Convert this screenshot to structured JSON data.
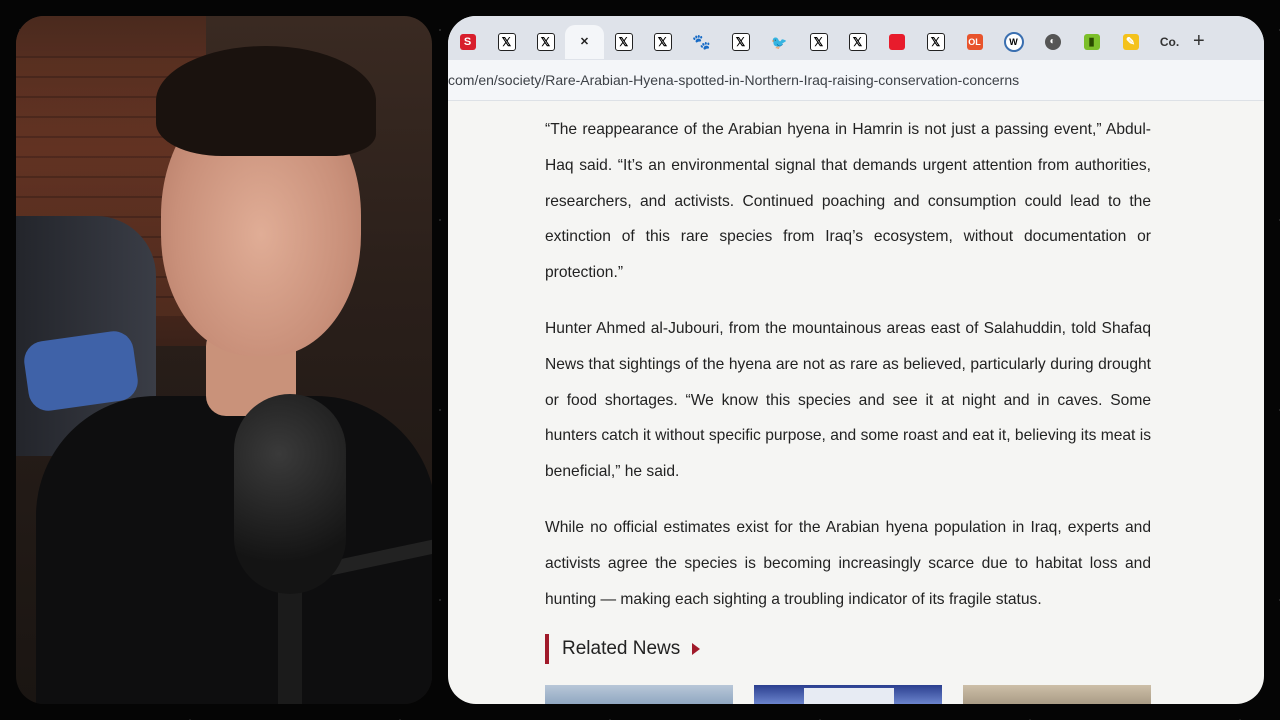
{
  "browser": {
    "tabs": [
      {
        "icon": "s-red-favicon-icon",
        "glyph": "S",
        "style": "s"
      },
      {
        "icon": "x-logo-icon",
        "glyph": "𝕏",
        "style": "x"
      },
      {
        "icon": "x-logo-icon",
        "glyph": "𝕏",
        "style": "x"
      },
      {
        "icon": "close-icon",
        "glyph": "✕",
        "style": "active"
      },
      {
        "icon": "x-logo-icon",
        "glyph": "𝕏",
        "style": "x"
      },
      {
        "icon": "x-logo-icon",
        "glyph": "𝕏",
        "style": "x"
      },
      {
        "icon": "paw-icon",
        "glyph": "🐾",
        "style": "paw"
      },
      {
        "icon": "x-logo-icon",
        "glyph": "𝕏",
        "style": "x"
      },
      {
        "icon": "bird-icon",
        "glyph": "🐦",
        "style": "bird"
      },
      {
        "icon": "x-logo-icon",
        "glyph": "𝕏",
        "style": "x"
      },
      {
        "icon": "x-logo-icon",
        "glyph": "𝕏",
        "style": "x"
      },
      {
        "icon": "red-square-icon",
        "glyph": "",
        "style": "red"
      },
      {
        "icon": "x-logo-icon",
        "glyph": "𝕏",
        "style": "x"
      },
      {
        "icon": "ol-favicon-icon",
        "glyph": "OL",
        "style": "ol"
      },
      {
        "icon": "wikipedia-icon",
        "glyph": "W",
        "style": "wiki"
      },
      {
        "icon": "globe-icon",
        "glyph": "◐",
        "style": "globe"
      },
      {
        "icon": "green-favicon-icon",
        "glyph": "▮",
        "style": "green"
      },
      {
        "icon": "yellow-favicon-icon",
        "glyph": "✎",
        "style": "yellow"
      },
      {
        "icon": "co-favicon-icon",
        "glyph": "Co.",
        "style": "co"
      }
    ],
    "new_tab": "+",
    "url": "com/en/society/Rare-Arabian-Hyena-spotted-in-Northern-Iraq-raising-conservation-concerns"
  },
  "article": {
    "paragraphs": [
      "“The reappearance of the Arabian hyena in Hamrin is not just a passing event,” Abdul-Haq said. “It’s an environmental signal that demands urgent attention from authorities, researchers, and activists. Continued poaching and consumption could lead to the extinction of this rare species from Iraq’s ecosystem, without documentation or protection.”",
      "Hunter Ahmed al-Jubouri, from the mountainous areas east of Salahuddin, told Shafaq News that sightings of the hyena are not as rare as believed, particularly during drought or food shortages. “We know this species and see it at night and in caves. Some hunters catch it without specific purpose, and some roast and eat it, believing its meat is beneficial,” he said.",
      "While no official estimates exist for the Arabian hyena population in Iraq, experts and activists agree the species is becoming increasingly scarce due to habitat loss and hunting — making each sighting a troubling indicator of its fragile status."
    ],
    "related_title": "Related News"
  },
  "colors": {
    "accent": "#a01a2a",
    "tabbar": "#dfe3ea",
    "page_bg": "#f5f5f3"
  }
}
